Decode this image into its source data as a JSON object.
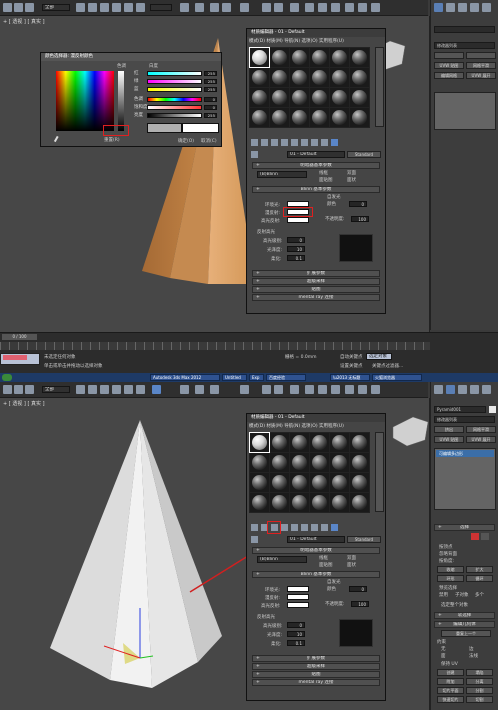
{
  "top": {
    "toolbar_dropdown": "全部",
    "viewport_label": "+ [ 透视 ] [ 真实 ]",
    "color_picker": {
      "title": "颜色选择器: 漫反射颜色",
      "hue_label": "色调",
      "whiteness_label": "白度",
      "channels": [
        {
          "label": "红",
          "value": "255"
        },
        {
          "label": "绿",
          "value": "255"
        },
        {
          "label": "蓝",
          "value": "255"
        },
        {
          "label": "色调",
          "value": "0"
        },
        {
          "label": "饱和度",
          "value": "0"
        },
        {
          "label": "亮度",
          "value": "255"
        }
      ],
      "blackness_label": "黑",
      "reset_label": "重置(R)",
      "ok_label": "确定(O)",
      "cancel_label": "取消(C)"
    },
    "material_editor": {
      "title": "材质编辑器 - 01 - Default",
      "menu": "模式(D)  材质(M)  导航(N)  选项(O)  实用程序(U)",
      "material_name": "01 - Default",
      "material_type": "Standard",
      "shader_rollout": "明暗器基本参数",
      "shader_type": "(B)Blinn",
      "wire_label": "线框",
      "two_sided_label": "双面",
      "face_map_label": "面贴图",
      "faceted_label": "面状",
      "basic_rollout": "Blinn 基本参数",
      "self_illum_label": "自发光",
      "color_label": "颜色",
      "color_value": "0",
      "ambient_label": "环境光:",
      "diffuse_label": "漫反射:",
      "specular_label": "高光反射:",
      "opacity_label": "不透明度:",
      "opacity_value": "100",
      "highlights_label": "反射高光",
      "spec_level_label": "高光级别:",
      "spec_level_value": "0",
      "glossiness_label": "光泽度:",
      "glossiness_value": "10",
      "soften_label": "柔化:",
      "soften_value": "0.1",
      "rollouts": [
        "扩展参数",
        "超级采样",
        "贴图",
        "mental ray 连接"
      ]
    },
    "cmd_panel": {
      "dropdown1": "修改器列表",
      "item1": "UVW 贴图",
      "item2": "网格平滑",
      "item3": "UVW 展开",
      "btn_edit": "编辑网格"
    },
    "timeline": "0 / 100",
    "status": {
      "selected": "未选定任何对象",
      "prompt": "单击或单击并拖动以选择对象",
      "grid": "栅格 = 0.0mm",
      "autokey": "自动关键点",
      "selected_obj": "选定对象",
      "setkey": "设置关键点",
      "keyfilter": "关键点过滤器..."
    }
  },
  "taskbar": {
    "items": [
      "Autodesk 3ds Max 2012",
      "Untitled",
      "Exp",
      "百度经验",
      "\\u2013 无标题",
      "火狐浏览器"
    ]
  },
  "bottom": {
    "toolbar_dropdown": "全部",
    "viewport_label": "+ [ 透视 ] [ 真实 ]",
    "material_editor": {
      "title": "材质编辑器 - 01 - Default",
      "menu": "模式(D)  材质(M)  导航(N)  选项(O)  实用程序(U)",
      "material_name": "01 - Default",
      "material_type": "Standard",
      "shader_rollout": "明暗器基本参数",
      "shader_type": "(B)Blinn",
      "wire_label": "线框",
      "two_sided_label": "双面",
      "face_map_label": "面贴图",
      "faceted_label": "面状",
      "basic_rollout": "Blinn 基本参数",
      "self_illum_label": "自发光",
      "color_label": "颜色",
      "color_value": "0",
      "ambient_label": "环境光:",
      "diffuse_label": "漫反射:",
      "specular_label": "高光反射:",
      "opacity_label": "不透明度:",
      "opacity_value": "100",
      "highlights_label": "反射高光",
      "spec_level_label": "高光级别:",
      "spec_level_value": "0",
      "glossiness_label": "光泽度:",
      "glossiness_value": "10",
      "soften_label": "柔化:",
      "soften_value": "0.1",
      "rollouts": [
        "扩展参数",
        "超级采样",
        "贴图",
        "mental ray 连接"
      ]
    },
    "cmd_panel": {
      "object_name": "Pyramid001",
      "dropdown1": "修改器列表",
      "btn_a": "挤出",
      "btn_b": "网格平滑",
      "btn_c": "UVW 贴图",
      "btn_d": "UVW 展开",
      "stack_item": "可编辑多边形",
      "select_rollout": "选择",
      "by_vertex": "按顶点",
      "ignore_back": "忽略背面",
      "by_angle": "按角度:",
      "shrink": "收缩",
      "grow": "扩大",
      "ring": "环形",
      "loop": "循环",
      "preview": "预览选择",
      "off": "禁用",
      "subobj": "子对象",
      "multi": "多个",
      "whole": "选定整个对象",
      "soft_rollout": "软选择",
      "edit_geo": "编辑几何体",
      "repeat": "重复上一个",
      "constraints": "约束",
      "none": "无",
      "edge": "边",
      "face": "面",
      "normal": "法线",
      "preserve_uv": "保持 UV",
      "create": "创建",
      "collapse": "塌陷",
      "attach": "附加",
      "detach": "分离",
      "slice_plane": "切片平面",
      "split": "分割",
      "slice": "切片",
      "reset_plane": "重置平面",
      "quickslice": "快速切片",
      "cut": "切割",
      "msmooth": "网格平滑",
      "tessellate": "细化",
      "make_planar": "平面化"
    }
  }
}
